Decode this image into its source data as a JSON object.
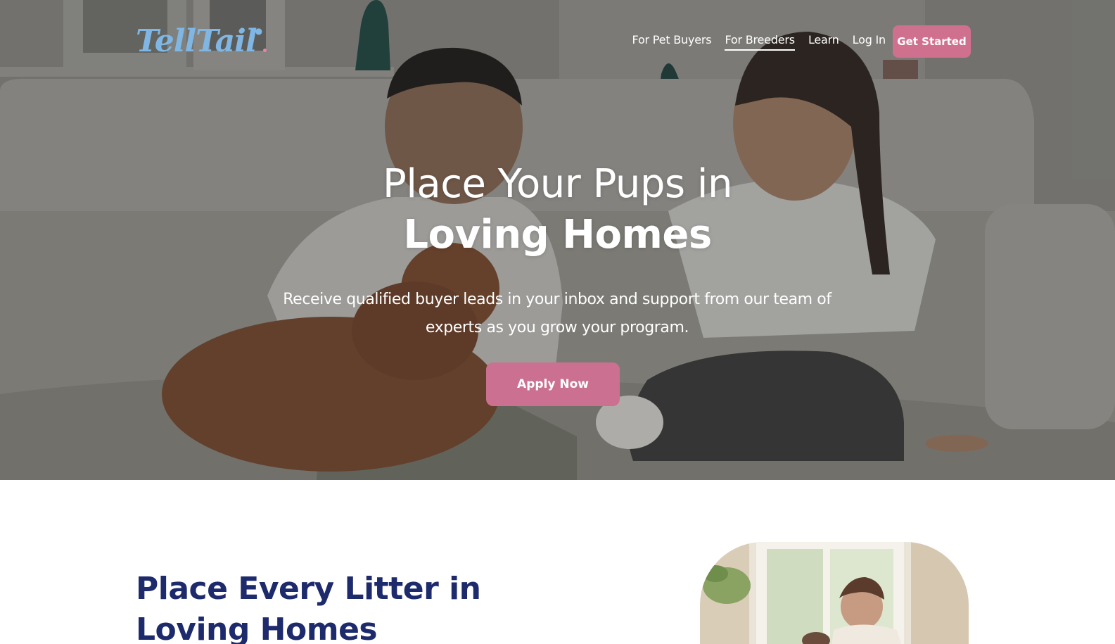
{
  "nav": {
    "logo_text": "TellTail",
    "links": [
      {
        "label": "For Pet Buyers",
        "active": false
      },
      {
        "label": "For Breeders",
        "active": true
      },
      {
        "label": "Learn",
        "active": false
      },
      {
        "label": "Log In",
        "active": false
      }
    ],
    "cta_label": "Get Started"
  },
  "hero": {
    "title_line1": "Place Your Pups in",
    "title_line2": "Loving Homes",
    "subtitle": "Receive qualified buyer leads in your inbox and support from our team of experts as you grow your program.",
    "button_label": "Apply Now",
    "image_alt": "Two children playing with a brown poodle puppy on a couch"
  },
  "section": {
    "title_line1": "Place Every Litter in",
    "title_line2": "Loving Homes",
    "image_alt": "Man with a puppy near a bright window"
  },
  "colors": {
    "brand_pink": "#cb7090",
    "logo_blue": "#7fb6e3",
    "heading_navy": "#1d2a6b"
  },
  "icons": {
    "logo_paw": "paw-icon"
  }
}
